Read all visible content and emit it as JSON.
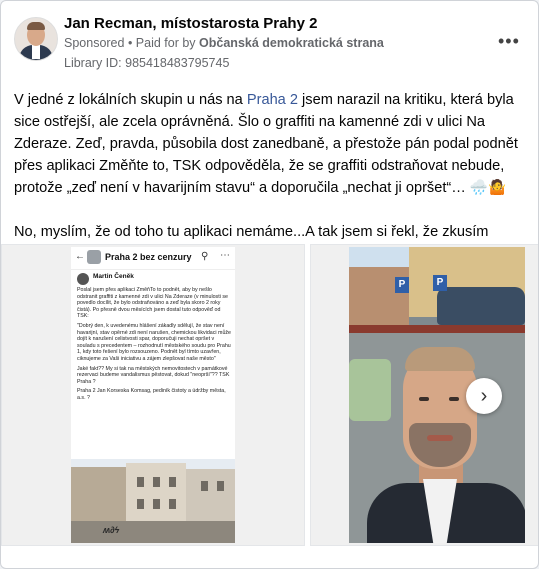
{
  "post": {
    "author": "Jan Recman, místostarosta Prahy 2",
    "sponsored": "Sponsored",
    "paid_for": "Paid for by",
    "sponsor": "Občanská demokratická strana",
    "library_id": "Library ID: 985418483795745",
    "more_icon": "more-dots-icon",
    "text_lines": [
      "V jedné z lokálních skupin u nás na",
      "Praha 2",
      "jsem narazil na kritiku, která byla sice ostřejší, ale zcela oprávněná. Šlo o graffiti na kamenné zdi v ulici Na Zderaze. Zeď, pravda, působila dost zanedbaně, a přestože pán podal podnět přes aplikaci Změňte to, TSK odpověděla, že se graffiti odstraňovat nebude, protože „zeď není v havarijním stavu“ a doporučila „nechat ji opršet“… 🌧️🤷"
    ],
    "text_second": "No, myslím, že od toho tu aplikaci nemáme...A tak jsem si řekl, že zkusím zjistit,..."
  },
  "screenshot": {
    "group_title": "Praha 2 bez cenzury",
    "author": "Martin Čeněk",
    "paragraphs": [
      "Poslal jsem přes aplikaci ZměňTo to podnět, aby by nešlo odstranit graffiti z kamenné zdi v ulici Na Zderaze (v minulosti se povedlo docílit, že bylo odstraňováno a zeď byla skoro 2 roky čistá). Po přesně dvou měsících jsem dostal tuto odpověď od TSK:",
      "\"Dobrý den, k uvedenému hlášení zákadly sdělují, že stav není havarijní, stav opěrné zdi není narušen, chemickou likvidaci může dojít k narušení celistvosti spar, doporučuji nechat opršet v souladu s precedentem – rozhodnutí městského soudu pro Prahu 1, kdy toto řešení bylo rozsouzeno. Podnět byl tímto uzavřen, ciknujeme za Vaši iniciativu a zájem zlepšovat naše město\"",
      "Jaké fakt?? My si tak na městských nemovitostech v památkové rezervaci budeme vandalismus pěstovat, dokud \"neoprší\"?? TSK Praha ?",
      "Praha 2 Jan Korseska Komsag, pediník čistoty a údržby města, a.s. ?"
    ],
    "graffiti": "ʍ∂ϟ"
  },
  "carousel": {
    "signs": [
      "P",
      "P"
    ],
    "next_icon": "chevron-right-icon",
    "next_glyph": "›"
  }
}
